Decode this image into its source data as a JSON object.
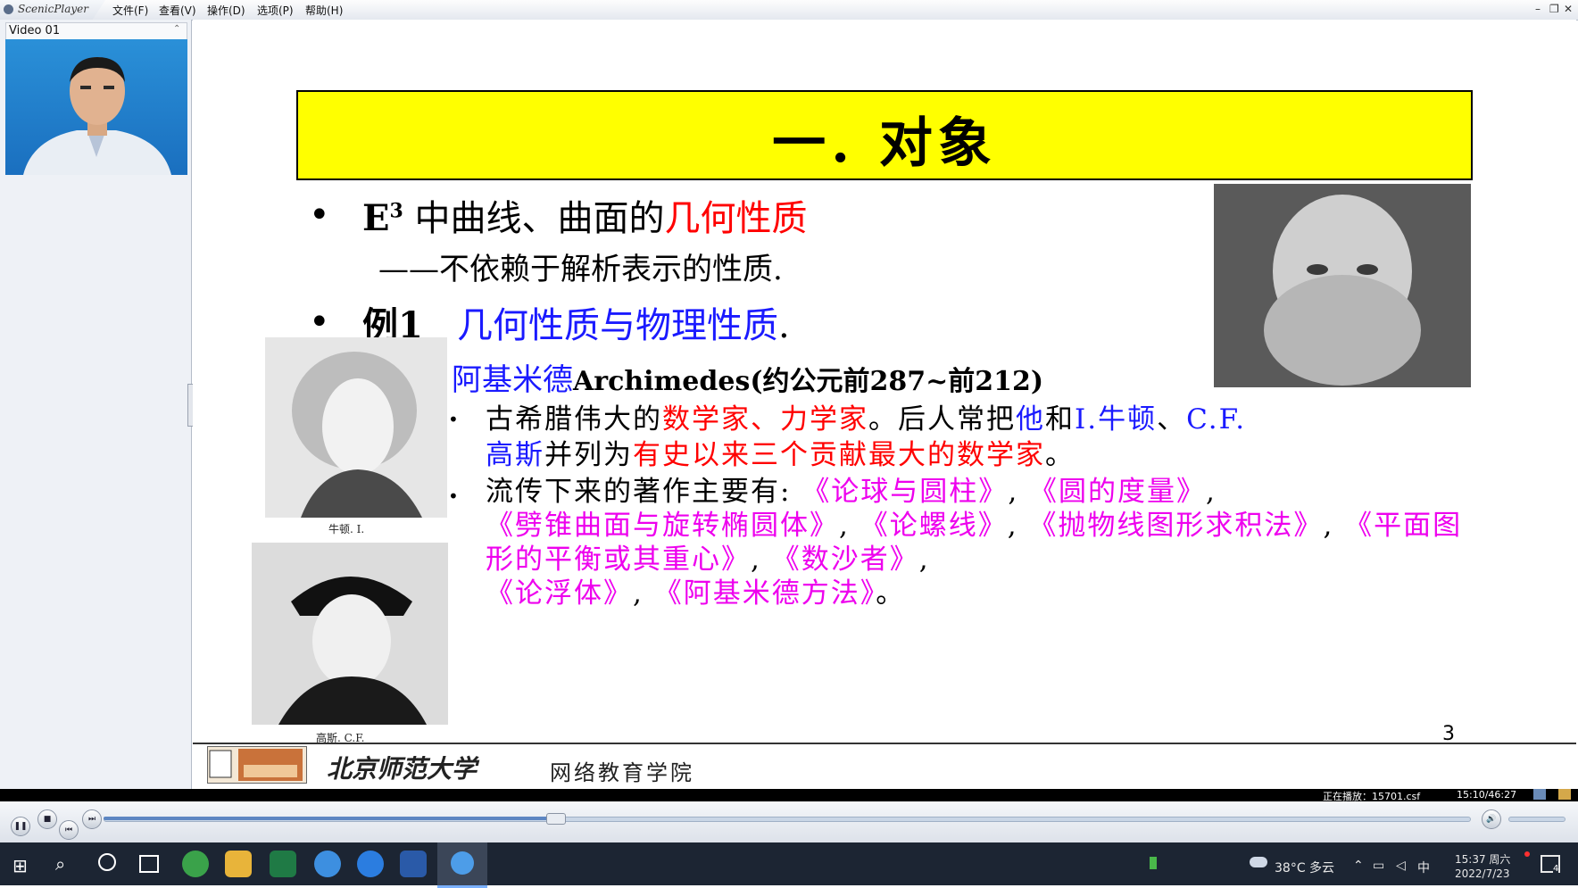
{
  "app": {
    "name": "ScenicPlayer",
    "menu": [
      "文件(F)",
      "查看(V)",
      "操作(D)",
      "选项(P)",
      "帮助(H)"
    ],
    "window_buttons": [
      "–",
      "❐",
      "✕"
    ]
  },
  "left_panel": {
    "video_label": "Video 01",
    "collapse_glyph": "⌃"
  },
  "slide": {
    "title": "一. 对象",
    "bullet1_prefix": "E",
    "bullet1_sup": "3",
    "bullet1_black": " 中曲线、曲面的",
    "bullet1_red": "几何性质",
    "bullet1_sub": "——不依赖于解析表示的性质.",
    "bullet2_label": "例1",
    "bullet2_blue": "几何性质与物理性质",
    "bullet2_end": ".",
    "arch_name_cn": "阿基米德",
    "arch_name_en": "Archimedes(约公元前287~前212)",
    "sub1": {
      "p1": "古希腊伟大的",
      "r1": "数学家、力学家",
      "p2": "。后人常把",
      "b1": "他",
      "p3": "和",
      "b2": "I.牛顿",
      "p4": "、",
      "b3": "C.F.",
      "b4": "高斯",
      "p5": "并列为",
      "r2": "有史以来三个贡献最大的数学家",
      "p6": "。"
    },
    "sub2": {
      "lead": "流传下来的著作主要有:",
      "w1": "《论球与圆柱》",
      "w2": "《圆的度量》",
      "w3": "《劈锥曲面与旋转椭圆体》",
      "w4": "《论螺线》",
      "w5": "《抛物线图形求积法》",
      "w6": "《平面图形的平衡或其重心》",
      "w7": "《数沙者》",
      "w8": "《论浮体》",
      "w9": "《阿基米德方法》",
      "sep": ",",
      "end": "。"
    },
    "caption_newton": "牛顿. I.",
    "caption_gauss": "高斯. C.F.",
    "page_number": "3",
    "footer_school": "北京师范大学",
    "footer_college": "网络教育学院"
  },
  "player": {
    "now_playing": "正在播放：15701.csf",
    "time": "15:10/46:27",
    "progress": 0.33
  },
  "taskbar": {
    "weather": "38°C 多云",
    "ime": "中",
    "clock_time": "15:37 周六",
    "clock_date": "2022/7/23",
    "notification_count": "4"
  },
  "colors": {
    "title_bg": "#ffff00",
    "emph_red": "#ff0000",
    "emph_blue": "#1a1aff",
    "emph_magenta": "#ee00ee",
    "taskbar": "#1c2533"
  }
}
